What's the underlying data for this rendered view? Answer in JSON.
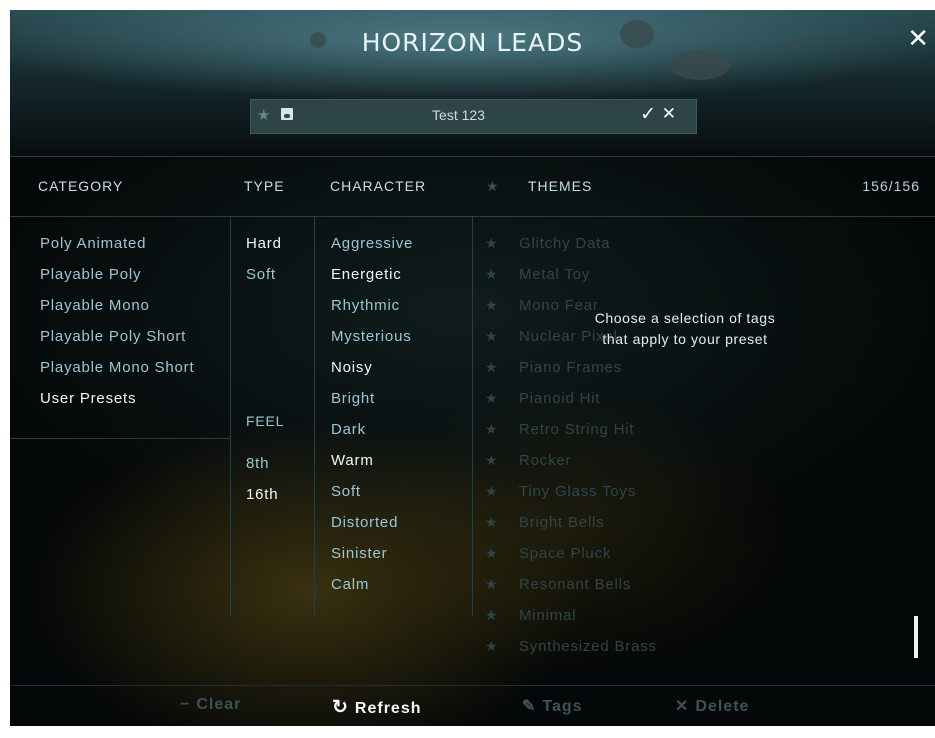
{
  "app": {
    "title": "HORIZON LEADS"
  },
  "preset": {
    "name": "Test 123"
  },
  "columns": {
    "category": "CATEGORY",
    "type": "TYPE",
    "character": "CHARACTER",
    "themes": "THEMES",
    "feel": "FEEL",
    "count": "156/156"
  },
  "category_items": [
    "Poly Animated",
    "Playable Poly",
    "Playable Mono",
    "Playable Poly Short",
    "Playable Mono Short",
    "User Presets"
  ],
  "type_items": [
    "Hard",
    "Soft"
  ],
  "feel_items": [
    "8th",
    "16th"
  ],
  "character_items": [
    "Aggressive",
    "Energetic",
    "Rhythmic",
    "Mysterious",
    "Noisy",
    "Bright",
    "Dark",
    "Warm",
    "Soft",
    "Distorted",
    "Sinister",
    "Calm"
  ],
  "theme_items": [
    "Glitchy Data",
    "Metal Toy",
    "Mono Fear",
    "Nuclear Pixel",
    "Piano Frames",
    "Pianoid Hit",
    "Retro String Hit",
    "Rocker",
    "Tiny Glass Toys",
    "Bright Bells",
    "Space Pluck",
    "Resonant Bells",
    "Minimal",
    "Synthesized Brass"
  ],
  "overlay": {
    "line1": "Choose a selection of tags",
    "line2": "that apply to your preset"
  },
  "footer": {
    "clear": "Clear",
    "refresh": "Refresh",
    "tags": "Tags",
    "delete": "Delete"
  },
  "icons": {
    "close": "close-icon",
    "star": "star-icon",
    "save": "save-icon",
    "check": "check-icon",
    "cancel": "cancel-icon",
    "clear": "minus-icon",
    "refresh": "refresh-icon",
    "tags": "pencil-icon",
    "delete": "x-icon"
  },
  "colors": {
    "accent": "#9cc7d2",
    "text_white": "#f2f7f8",
    "disabled": "#2f4549"
  }
}
